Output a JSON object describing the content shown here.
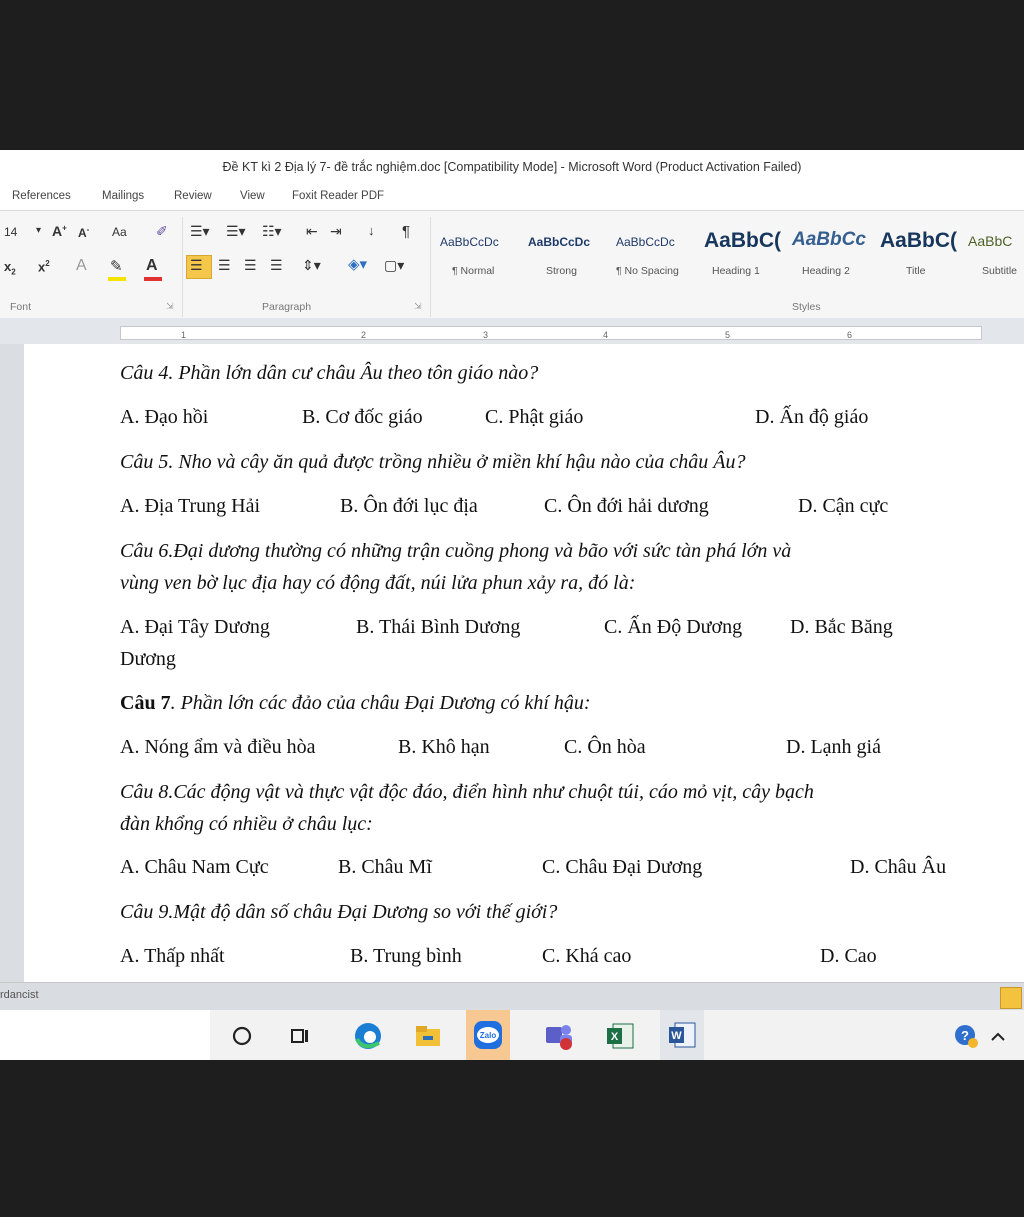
{
  "window": {
    "title": "Đề KT kì 2 Địa lý 7- đề trắc nghiệm.doc [Compatibility Mode] - Microsoft Word (Product Activation Failed)"
  },
  "menu": {
    "tabs": [
      "References",
      "Mailings",
      "Review",
      "View",
      "Foxit Reader PDF"
    ]
  },
  "ribbon": {
    "font_size": "14",
    "change_case": "Aa",
    "group_font": "Font",
    "group_paragraph": "Paragraph",
    "group_styles": "Styles",
    "styles": [
      {
        "sample": "AaBbCcDc",
        "name": "¶ Normal"
      },
      {
        "sample": "AaBbCcDc",
        "name": "Strong"
      },
      {
        "sample": "AaBbCcDc",
        "name": "¶ No Spacing"
      },
      {
        "sample": "AaBbC(",
        "name": "Heading 1"
      },
      {
        "sample": "AaBbCc",
        "name": "Heading 2"
      },
      {
        "sample": "AaBbC(",
        "name": "Title"
      },
      {
        "sample": "AaBbC",
        "name": "Subtitle"
      }
    ]
  },
  "ruler": {
    "ticks": [
      "1",
      "2",
      "3",
      "4",
      "5",
      "6"
    ]
  },
  "document": {
    "questions": [
      {
        "text": "Câu 4. Phần lớn dân cư châu Âu theo tôn giáo nào?",
        "options": [
          "A. Đạo hồi",
          "B. Cơ đốc giáo",
          "C. Phật giáo",
          "D. Ấn độ giáo"
        ]
      },
      {
        "text": "Câu 5. Nho và cây ăn quả được trồng nhiều ở miền khí hậu nào của châu Âu?",
        "options": [
          "A. Địa Trung Hải",
          "B. Ôn đới lục địa",
          "C. Ôn đới hải dương",
          "D. Cận cực"
        ]
      },
      {
        "line1": "Câu 6.Đại dương thường có những trận cuồng phong và bão với sức tàn phá lớn và",
        "line2": "vùng ven bờ lục địa hay có động đất, núi lửa phun xảy ra, đó là:",
        "options": [
          "A.  Đại Tây Dương",
          "B. Thái Bình Dương",
          "C. Ấn Độ Dương",
          "D. Bắc Băng"
        ],
        "option_wrap": "Dương"
      },
      {
        "label": "Câu 7",
        "rest": ". Phần lớn các đảo của châu Đại Dương có khí hậu:",
        "options": [
          "A. Nóng ẩm và điều hòa",
          "B. Khô hạn",
          "C. Ôn hòa",
          "D. Lạnh giá"
        ]
      },
      {
        "line1": "Câu 8.Các động vật và thực vật độc đáo, điển hình như chuột túi, cáo mỏ vịt, cây bạch",
        "line2": "đàn khổng có nhiều ở châu lục:",
        "options": [
          "A. Châu Nam Cực",
          "B. Châu Mĩ",
          "C. Châu Đại Dương",
          "D. Châu Âu"
        ]
      },
      {
        "text": "Câu 9.Mật độ dân số châu Đại Dương so với thế giới?",
        "options": [
          "A. Thấp nhất",
          "B. Trung bình",
          "C. Khá cao",
          "D. Cao"
        ]
      }
    ]
  },
  "status": {
    "text": "rdancist"
  },
  "taskbar": {
    "apps": [
      "search-circle",
      "task-view",
      "edge",
      "file-explorer",
      "zalo",
      "teams",
      "excel",
      "word"
    ],
    "tray": [
      "help",
      "chevron-up"
    ]
  }
}
